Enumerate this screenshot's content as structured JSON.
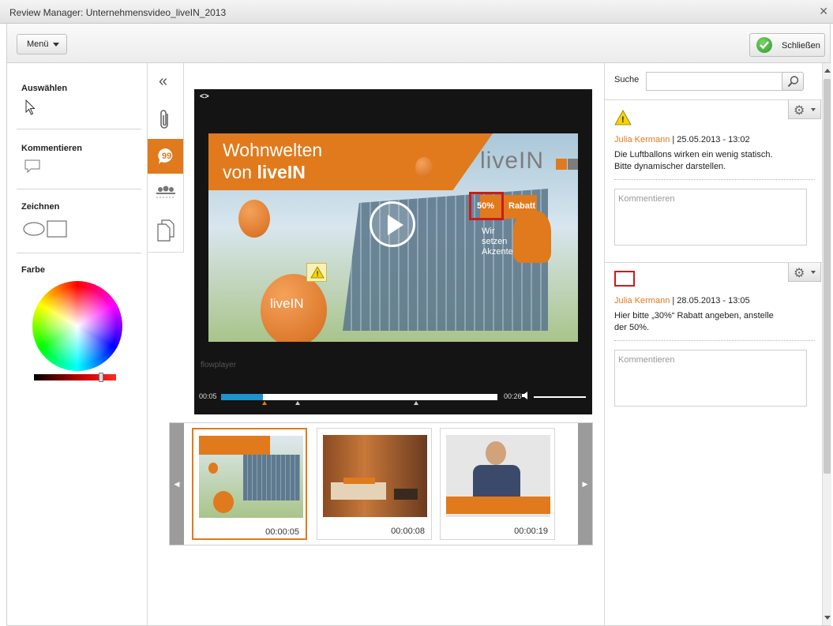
{
  "window": {
    "title": "Review Manager: Unternehmensvideo_liveIN_2013"
  },
  "toolbar": {
    "menu_label": "Menü",
    "close_label": "Schließen"
  },
  "tools": {
    "select_title": "Auswählen",
    "comment_title": "Kommentieren",
    "draw_title": "Zeichnen",
    "color_title": "Farbe"
  },
  "player": {
    "current_time": "00:05",
    "end_time": "00:26",
    "progress": 0.15,
    "watermark": "flowplayer",
    "frame": {
      "headline_line1": "Wohnwelten",
      "headline_line2_prefix": "von ",
      "headline_line2_brand": "liveIN",
      "brand": "liveIN",
      "promo_percent": "50%",
      "promo_label": "Rabatt",
      "promo_sub": "Wir setzen Akzente.",
      "balloon_logo": "liveIN"
    }
  },
  "thumbnails": [
    {
      "time": "00:00:05",
      "selected": true
    },
    {
      "time": "00:00:08",
      "selected": false
    },
    {
      "time": "00:00:19",
      "selected": false
    }
  ],
  "search": {
    "label": "Suche",
    "value": ""
  },
  "comments": [
    {
      "author": "Julia Kermann",
      "date": "| 25.05.2013 - 13:02",
      "text_line1": "Die Luftballons wirken ein wenig statisch.",
      "text_line2": "Bitte dynamischer darstellen.",
      "reply_placeholder": "Kommentieren",
      "marker": "warning"
    },
    {
      "author": "Julia Kermann",
      "date": "| 28.05.2013 - 13:05",
      "text_line1": "Hier bitte „30%“ Rabatt angeben, anstelle",
      "text_line2": "der 50%.",
      "reply_placeholder": "Kommentieren",
      "marker": "rectangle"
    }
  ],
  "colors": {
    "accent": "#e07a1c",
    "highlight": "#cc1b1b",
    "progress": "#1d93cf"
  }
}
